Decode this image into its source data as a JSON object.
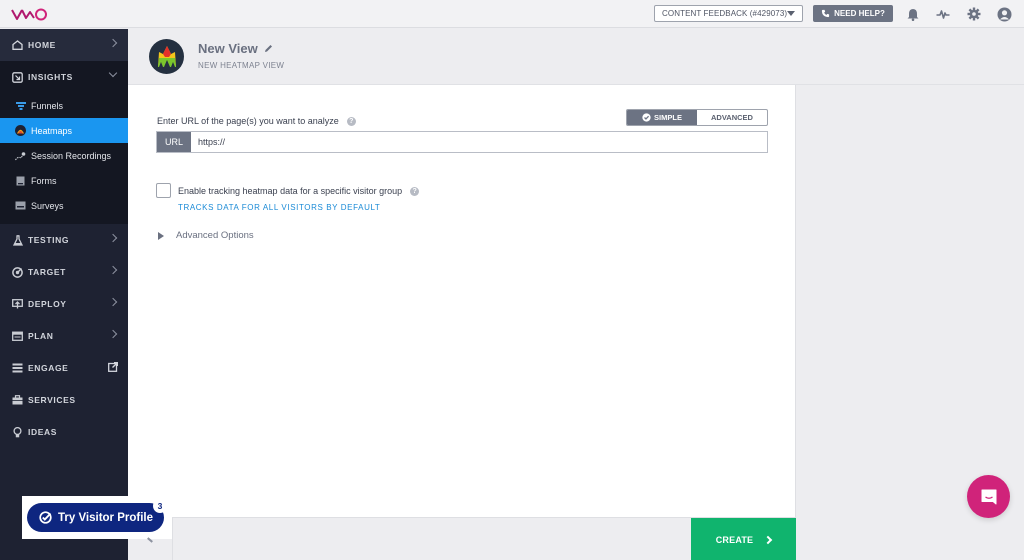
{
  "app": {
    "logo_text": "VWO",
    "brand_color": "#b0186e"
  },
  "topbar": {
    "project_select": "CONTENT FEEDBACK (#429073)",
    "help_label": "NEED HELP?",
    "icons": [
      "bell-icon",
      "activity-icon",
      "gear-icon",
      "user-icon"
    ]
  },
  "sidebar": {
    "sections": {
      "home": "HOME",
      "insights": "INSIGHTS",
      "testing": "TESTING",
      "target": "TARGET",
      "deploy": "DEPLOY",
      "plan": "PLAN",
      "engage": "ENGAGE",
      "services": "SERVICES",
      "ideas": "IDEAS"
    },
    "insights_items": {
      "funnels": "Funnels",
      "heatmaps": "Heatmaps",
      "session_recordings": "Session Recordings",
      "forms": "Forms",
      "surveys": "Surveys"
    },
    "active_item": "Heatmaps",
    "active_color": "#1a96f0"
  },
  "header": {
    "title": "New View",
    "subtitle": "NEW HEATMAP VIEW"
  },
  "form": {
    "url_label": "Enter URL of the page(s) you want to analyze",
    "mode_simple": "SIMPLE",
    "mode_advanced": "ADVANCED",
    "selected_mode": "SIMPLE",
    "url_addon": "URL",
    "url_value": "https://",
    "visitor_group_label": "Enable tracking heatmap data for a specific visitor group",
    "visitor_group_checked": false,
    "visitor_group_hint": "TRACKS DATA FOR ALL VISITORS BY DEFAULT",
    "advanced_options": "Advanced Options"
  },
  "footer": {
    "create_label": "CREATE",
    "create_color": "#10b46e"
  },
  "widgets": {
    "visitor_profile_label": "Try Visitor Profile",
    "visitor_profile_badge": "3",
    "chat_color": "#d0237a"
  }
}
